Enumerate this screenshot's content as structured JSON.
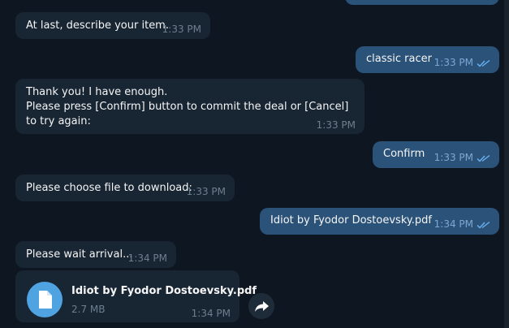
{
  "messages": [
    {
      "text": "At last, describe your item.",
      "time": "1:33 PM"
    },
    {
      "text": "classic racer",
      "time": "1:33 PM"
    },
    {
      "text": "Thank you! I have enough.\nPlease press [Confirm] button to commit the deal or [Cancel] to try again:",
      "time": "1:33 PM"
    },
    {
      "text": "Confirm",
      "time": "1:33 PM"
    },
    {
      "text": "Please choose file to download:",
      "time": "1:33 PM"
    },
    {
      "text": "Idiot by Fyodor Dostoevsky.pdf",
      "time": "1:34 PM"
    },
    {
      "text": "Please wait arrival...",
      "time": "1:34 PM"
    }
  ],
  "file_message": {
    "file_name": "Idiot by Fyodor Dostoevsky.pdf",
    "file_size": "2.7 MB",
    "time": "1:34 PM",
    "icon": "document-icon"
  },
  "forward_icon": "forward-arrow-icon",
  "colors": {
    "background": "#0e1621",
    "incoming_bubble": "#182533",
    "outgoing_bubble": "#2b5278",
    "read_checks": "#6ab2f2",
    "file_icon": "#4fa3e0"
  }
}
